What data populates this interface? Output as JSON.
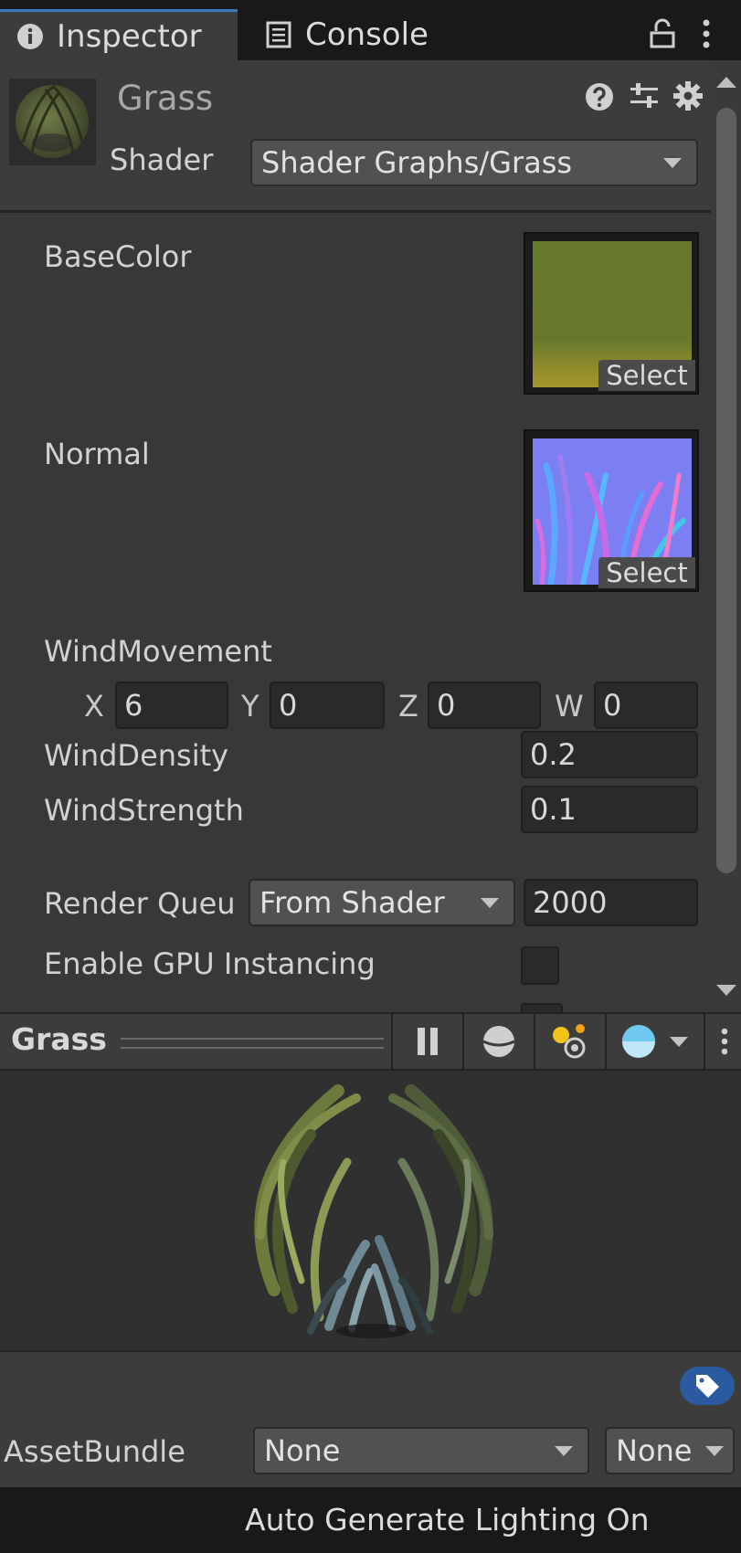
{
  "tabs": [
    {
      "label": "Inspector",
      "icon": "info-icon",
      "active": true
    },
    {
      "label": "Console",
      "icon": "console-icon",
      "active": false
    }
  ],
  "material": {
    "name": "Grass",
    "shader_label": "Shader",
    "shader_value": "Shader Graphs/Grass"
  },
  "properties": {
    "base_color": {
      "label": "BaseColor",
      "select_label": "Select"
    },
    "normal": {
      "label": "Normal",
      "select_label": "Select"
    },
    "wind_movement": {
      "label": "WindMovement",
      "x_label": "X",
      "x": "6",
      "y_label": "Y",
      "y": "0",
      "z_label": "Z",
      "z": "0",
      "w_label": "W",
      "w": "0"
    },
    "wind_density": {
      "label": "WindDensity",
      "value": "0.2"
    },
    "wind_strength": {
      "label": "WindStrength",
      "value": "0.1"
    },
    "render_queue": {
      "label": "Render Queu",
      "mode": "From Shader",
      "value": "2000"
    },
    "gpu_instancing": {
      "label": "Enable GPU Instancing",
      "checked": false
    }
  },
  "preview": {
    "title": "Grass"
  },
  "asset_bundle": {
    "label": "AssetBundle",
    "name": "None",
    "variant": "None"
  },
  "status": {
    "text": "Auto Generate Lighting On"
  },
  "colors": {
    "accent": "#3a79bb",
    "panel": "#383838",
    "tag_badge": "#2c5aa0"
  }
}
